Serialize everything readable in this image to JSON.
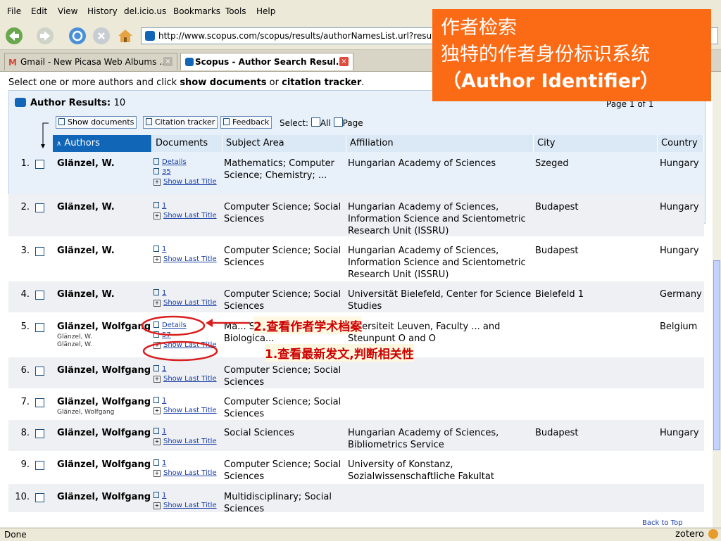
{
  "menu": {
    "items": [
      "File",
      "Edit",
      "View",
      "History",
      "del.icio.us",
      "Bookmarks",
      "Tools",
      "Help"
    ]
  },
  "nav": {
    "url": "http://www.scopus.com/scopus/results/authorNamesList.url?resultsPer"
  },
  "tabs": [
    {
      "label": "Gmail - New Picasa Web Albums ...",
      "active": false
    },
    {
      "label": "Scopus - Author Search Resul...",
      "active": true
    }
  ],
  "content": {
    "instruction": {
      "pre": "Select one or more authors and click ",
      "b1": "show documents",
      "mid": " or ",
      "b2": "citation tracker",
      "post": "."
    },
    "results_label": "Author Results:",
    "results_count": "10",
    "page_info": "Page 1 of 1",
    "toolbar": {
      "show_documents": "Show documents",
      "citation_tracker": "Citation tracker",
      "feedback": "Feedback",
      "select_label": "Select:",
      "all_label": "All",
      "page_label": "Page"
    },
    "columns": [
      "Authors",
      "Documents",
      "Subject Area",
      "Affiliation",
      "City",
      "Country"
    ],
    "show_last_title": "Show Last Title",
    "details_label": "Details",
    "rows": [
      {
        "num": "1.",
        "author": "Glänzel, W.",
        "alt_names": [],
        "details": true,
        "docs": "35",
        "subject": "Mathematics; Computer Science; Chemistry; ...",
        "affiliation": "Hungarian Academy of Sciences",
        "city": "Szeged",
        "country": "Hungary"
      },
      {
        "num": "2.",
        "author": "Glänzel, W.",
        "alt_names": [],
        "details": false,
        "docs": "1",
        "subject": "Computer Science; Social Sciences",
        "affiliation": "Hungarian Academy of Sciences, Information Science and Scientometric Research Unit (ISSRU)",
        "city": "Budapest",
        "country": "Hungary"
      },
      {
        "num": "3.",
        "author": "Glänzel, W.",
        "alt_names": [],
        "details": false,
        "docs": "1",
        "subject": "Computer Science; Social Sciences",
        "affiliation": "Hungarian Academy of Sciences, Information Science and Scientometric Research Unit (ISSRU)",
        "city": "Budapest",
        "country": "Hungary"
      },
      {
        "num": "4.",
        "author": "Glänzel, W.",
        "alt_names": [],
        "details": false,
        "docs": "1",
        "subject": "Computer Science; Social Sciences",
        "affiliation": "Universität Bielefeld, Center for Science Studies",
        "city": "Bielefeld 1",
        "country": "Germany"
      },
      {
        "num": "5.",
        "author": "Glänzel, Wolfgang",
        "alt_names": [
          "Glänzel, W.",
          "Glänzel, W."
        ],
        "details": true,
        "docs": "57",
        "subject": "Ma... Science; ... Biologica...",
        "affiliation": "...versiteit Leuven, Faculty ... and Steunpunt O and O",
        "city": "",
        "country": "Belgium"
      },
      {
        "num": "6.",
        "author": "Glänzel, Wolfgang",
        "alt_names": [],
        "details": false,
        "docs": "1",
        "subject": "Computer Science; Social Sciences",
        "affiliation": "",
        "city": "",
        "country": ""
      },
      {
        "num": "7.",
        "author": "Glänzel, Wolfgang",
        "alt_names": [
          "Glänzel, Wolfgang"
        ],
        "details": false,
        "docs": "1",
        "subject": "Computer Science; Social Sciences",
        "affiliation": "",
        "city": "",
        "country": ""
      },
      {
        "num": "8.",
        "author": "Glänzel, Wolfgang",
        "alt_names": [],
        "details": false,
        "docs": "1",
        "subject": "Social Sciences",
        "affiliation": "Hungarian Academy of Sciences, Bibliometrics Service",
        "city": "Budapest",
        "country": "Hungary"
      },
      {
        "num": "9.",
        "author": "Glänzel, Wolfgang",
        "alt_names": [],
        "details": false,
        "docs": "1",
        "subject": "Computer Science; Social Sciences",
        "affiliation": "University of Konstanz, Sozialwissenschaftliche Fakultat",
        "city": "",
        "country": ""
      },
      {
        "num": "10.",
        "author": "Glänzel, Wolfgang",
        "alt_names": [],
        "details": false,
        "docs": "1",
        "subject": "Multidisciplinary; Social Sciences",
        "affiliation": "",
        "city": "",
        "country": ""
      }
    ],
    "back_to_top": "Back to Top"
  },
  "overlay": {
    "line1": "作者检索",
    "line2": "独特的作者身份标识系统",
    "line3": "（Author Identifier）",
    "annotation_details": "2.查看作者学术档案",
    "annotation_last_title": "1.查看最新发文,判断相关性"
  },
  "status": {
    "text": "Done",
    "zotero": "zotero"
  },
  "colors": {
    "overlay_bg": "#fb6a14",
    "header_selected": "#1166b8",
    "link": "#1a3fa6",
    "annotation": "#cc0000"
  }
}
